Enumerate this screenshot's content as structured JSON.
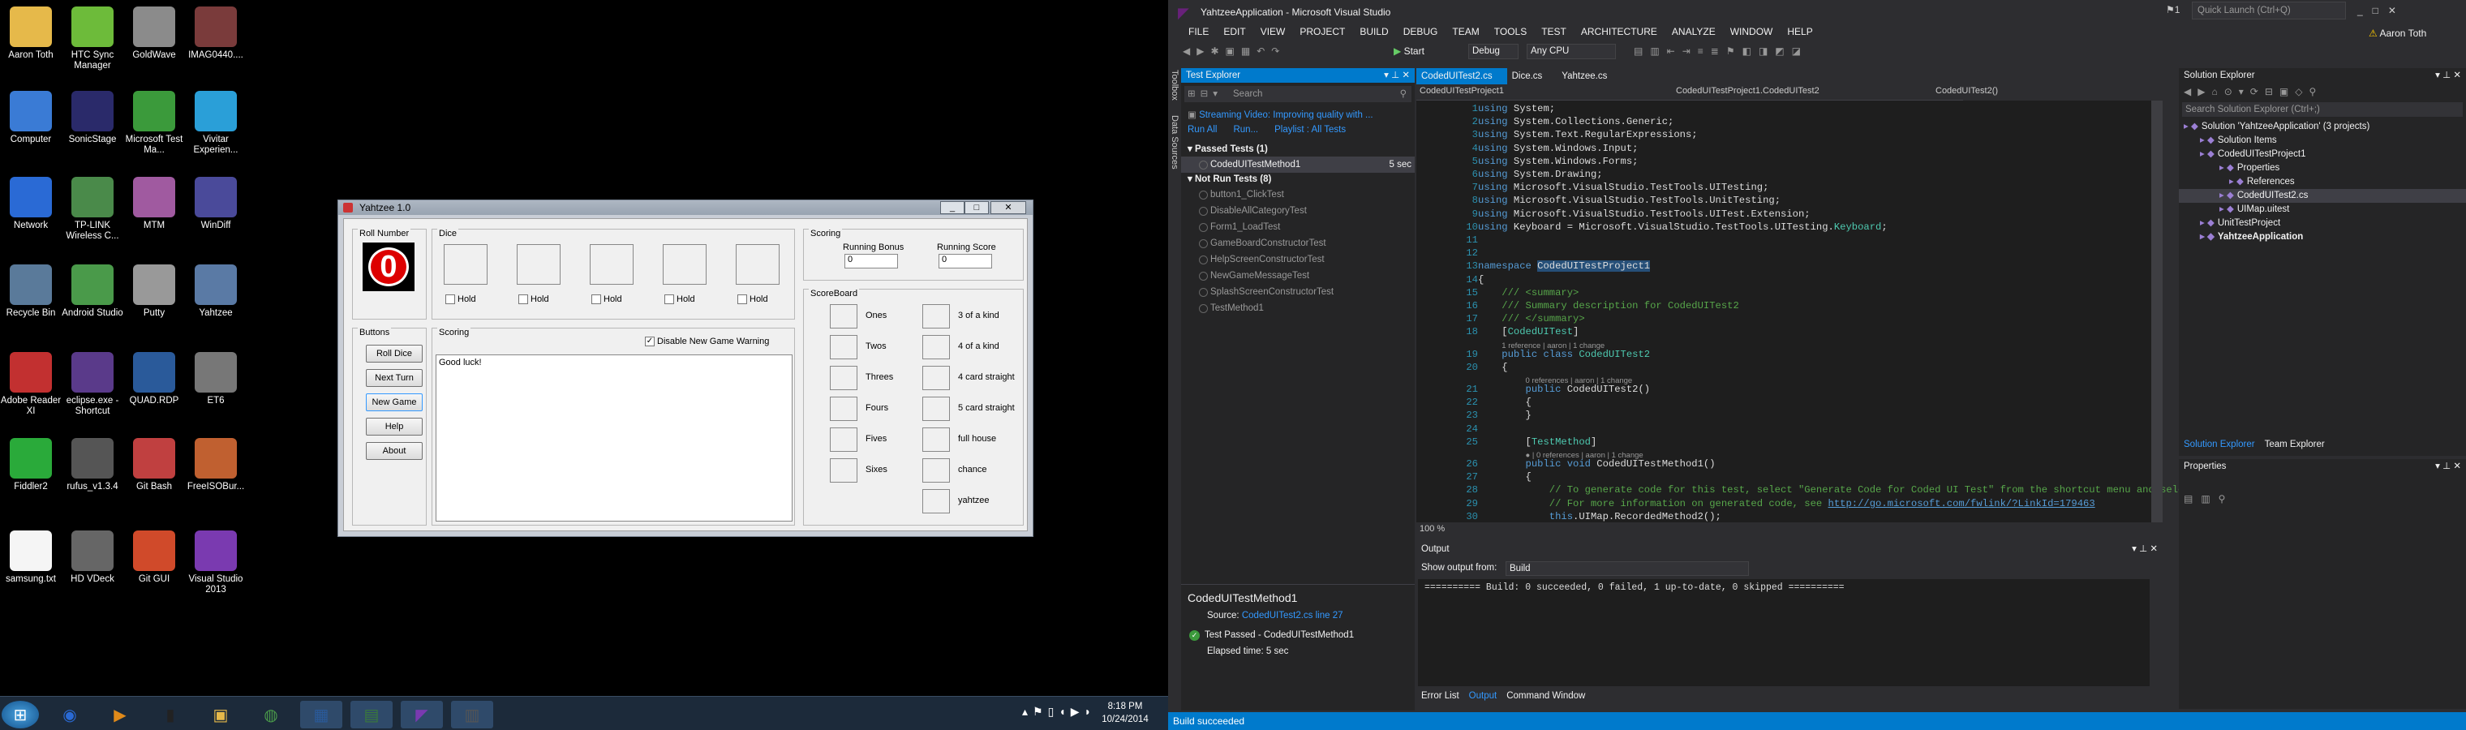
{
  "desktop": {
    "icons": [
      "Aaron Toth",
      "HTC Sync Manager",
      "GoldWave",
      "IMAG0440....",
      "Computer",
      "SonicStage",
      "Microsoft Test Ma...",
      "Vivitar Experien...",
      "Network",
      "TP-LINK Wireless C...",
      "MTM",
      "WinDiff",
      "Recycle Bin",
      "Android Studio",
      "Putty",
      "Yahtzee",
      "Adobe Reader XI",
      "eclipse.exe - Shortcut",
      "QUAD.RDP",
      "ET6",
      "Fiddler2",
      "rufus_v1.3.4",
      "Git Bash",
      "FreeISOBur...",
      "samsung.txt",
      "HD VDeck",
      "Git GUI",
      "Visual Studio 2013"
    ],
    "clock": {
      "time": "8:18 PM",
      "date": "10/24/2014"
    }
  },
  "yahtzee": {
    "title": "Yahtzee 1.0",
    "roll_number_label": "Roll Number",
    "roll_number": "0",
    "dice_label": "Dice",
    "hold": "Hold",
    "scoring_label": "Scoring",
    "running_bonus": "Running Bonus",
    "running_score": "Running Score",
    "bonus_value": "0",
    "score_value": "0",
    "buttons_label": "Buttons",
    "buttons": [
      "Roll Dice",
      "Next Turn",
      "New Game",
      "Help",
      "About"
    ],
    "scoring_area_label": "Scoring",
    "disable_warning": "Disable New Game Warning",
    "scoring_text": "Good luck!",
    "scoreboard_label": "ScoreBoard",
    "left_scores": [
      "Ones",
      "Twos",
      "Threes",
      "Fours",
      "Fives",
      "Sixes"
    ],
    "right_scores": [
      "3 of a kind",
      "4 of a kind",
      "4 card straight",
      "5 card straight",
      "full house",
      "chance",
      "yahtzee"
    ]
  },
  "vs": {
    "title": "YahtzeeApplication - Microsoft Visual Studio",
    "quick_launch": "Quick Launch (Ctrl+Q)",
    "notif": "1",
    "user": "Aaron Toth",
    "menu": [
      "FILE",
      "EDIT",
      "VIEW",
      "PROJECT",
      "BUILD",
      "DEBUG",
      "TEAM",
      "TOOLS",
      "TEST",
      "ARCHITECTURE",
      "ANALYZE",
      "WINDOW",
      "HELP"
    ],
    "toolbar": {
      "start": "Start",
      "config": "Debug",
      "platform": "Any CPU"
    },
    "side_tabs": [
      "Toolbox",
      "Data Sources"
    ],
    "test_explorer": {
      "title": "Test Explorer",
      "search": "Search",
      "banner": "Streaming Video: Improving quality with ...",
      "run_all": "Run All",
      "run": "Run...",
      "playlist": "Playlist : All Tests",
      "passed_header": "Passed Tests (1)",
      "passed": [
        {
          "name": "CodedUITestMethod1",
          "time": "5 sec"
        }
      ],
      "notrun_header": "Not Run Tests (8)",
      "notrun": [
        "button1_ClickTest",
        "DisableAllCategoryTest",
        "Form1_LoadTest",
        "GameBoardConstructorTest",
        "HelpScreenConstructorTest",
        "NewGameMessageTest",
        "SplashScreenConstructorTest",
        "TestMethod1"
      ],
      "detail_title": "CodedUITestMethod1",
      "source_label": "Source:",
      "source_link": "CodedUITest2.cs line 27",
      "result": "Test Passed - CodedUITestMethod1",
      "elapsed": "Elapsed time: 5 sec"
    },
    "tabs": [
      "CodedUITest2.cs",
      "Dice.cs",
      "Yahtzee.cs"
    ],
    "nav": [
      "CodedUITestProject1",
      "CodedUITestProject1.CodedUITest2",
      "CodedUITest2()"
    ],
    "zoom": "100 %",
    "output": {
      "title": "Output",
      "show_from": "Show output from:",
      "source": "Build",
      "text": "========== Build: 0 succeeded, 0 failed, 1 up-to-date, 0 skipped ==========",
      "tabs": [
        "Error List",
        "Output",
        "Command Window"
      ]
    },
    "solution": {
      "title": "Solution Explorer",
      "search": "Search Solution Explorer (Ctrl+;)",
      "items": [
        "Solution 'YahtzeeApplication' (3 projects)",
        "Solution Items",
        "CodedUITestProject1",
        "Properties",
        "References",
        "CodedUITest2.cs",
        "UIMap.uitest",
        "UnitTestProject",
        "YahtzeeApplication"
      ],
      "tabs": [
        "Solution Explorer",
        "Team Explorer"
      ]
    },
    "properties": {
      "title": "Properties"
    },
    "status": "Build succeeded"
  }
}
